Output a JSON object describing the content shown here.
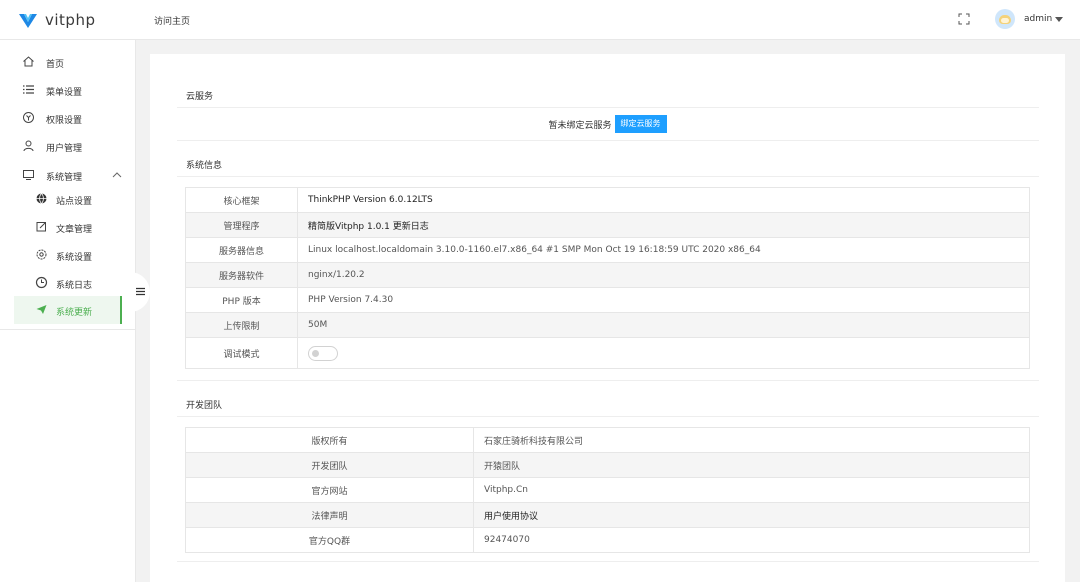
{
  "header": {
    "brand": "vitphp",
    "visit_home": "访问主页",
    "username": "admin",
    "colors": {
      "brand_primary": "#1e88e5",
      "brand_secondary": "#4fc3f7"
    }
  },
  "sidebar": {
    "items": [
      {
        "label": "首页",
        "icon": "home-icon"
      },
      {
        "label": "菜单设置",
        "icon": "list-icon"
      },
      {
        "label": "权限设置",
        "icon": "permission-icon"
      },
      {
        "label": "用户管理",
        "icon": "user-icon"
      },
      {
        "label": "系统管理",
        "icon": "monitor-icon",
        "expanded": true
      }
    ],
    "sub_items": [
      {
        "label": "站点设置",
        "icon": "globe-icon"
      },
      {
        "label": "文章管理",
        "icon": "edit-icon"
      },
      {
        "label": "系统设置",
        "icon": "gear-icon"
      },
      {
        "label": "系统日志",
        "icon": "clock-icon"
      },
      {
        "label": "系统更新",
        "icon": "send-icon",
        "active": true
      }
    ],
    "active_color": "#4caf50"
  },
  "cloud": {
    "title": "云服务",
    "message": "暂未绑定云服务",
    "bind_button": "绑定云服务",
    "button_color": "#1e9fff"
  },
  "system_info": {
    "title": "系统信息",
    "rows": [
      {
        "key": "核心框架",
        "value": "ThinkPHP Version 6.0.12LTS"
      },
      {
        "key": "管理程序",
        "value": "精简版Vitphp 1.0.1 更新日志"
      },
      {
        "key": "服务器信息",
        "value": "Linux localhost.localdomain 3.10.0-1160.el7.x86_64 #1 SMP Mon Oct 19 16:18:59 UTC 2020 x86_64"
      },
      {
        "key": "服务器软件",
        "value": "nginx/1.20.2"
      },
      {
        "key": "PHP 版本",
        "value": "PHP Version 7.4.30"
      },
      {
        "key": "上传限制",
        "value": "50M"
      },
      {
        "key": "调试模式",
        "value": ""
      }
    ],
    "debug_mode_on": false
  },
  "dev_team": {
    "title": "开发团队",
    "rows": [
      {
        "key": "版权所有",
        "value": "石家庄骑析科技有限公司"
      },
      {
        "key": "开发团队",
        "value": "开猿团队"
      },
      {
        "key": "官方网站",
        "value": "Vitphp.Cn"
      },
      {
        "key": "法律声明",
        "value": "用户使用协议"
      },
      {
        "key": "官方QQ群",
        "value": "92474070"
      }
    ]
  }
}
